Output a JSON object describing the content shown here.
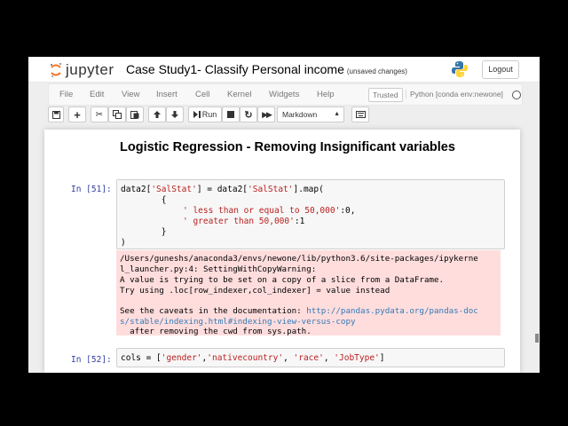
{
  "header": {
    "logo_text": "jupyter",
    "notebook_title": "Case Study1- Classify Personal income",
    "autosave_status": "(unsaved changes)",
    "logout_label": "Logout"
  },
  "menubar": {
    "items": [
      "File",
      "Edit",
      "View",
      "Insert",
      "Cell",
      "Kernel",
      "Widgets",
      "Help"
    ],
    "trusted_label": "Trusted",
    "kernel_name": "Python [conda env:newone]"
  },
  "toolbar": {
    "run_label": "Run",
    "cell_type": "Markdown"
  },
  "cells": {
    "heading": "Logistic Regression - Removing Insignificant variables",
    "cell1": {
      "prompt": "In [51]:",
      "line1_a": "data2[",
      "line1_b": "'SalStat'",
      "line1_c": "] = data2[",
      "line1_d": "'SalStat'",
      "line1_e": "].map(",
      "line2": "        {",
      "line3_str": "' less than or equal to 50,000'",
      "line3_rest": ":0,",
      "line4_str": "' greater than 50,000'",
      "line4_rest": ":1",
      "line5": "        }",
      "line6": ")"
    },
    "stderr": {
      "line1": "/Users/guneshs/anaconda3/envs/newone/lib/python3.6/site-packages/ipykerne",
      "line2": "l_launcher.py:4: SettingWithCopyWarning:",
      "line3": "A value is trying to be set on a copy of a slice from a DataFrame.",
      "line4": "Try using .loc[row_indexer,col_indexer] = value instead",
      "line5_text": "See the caveats in the documentation: ",
      "line5_link": "http://pandas.pydata.org/pandas-doc",
      "line6_link": "s/stable/indexing.html#indexing-view-versus-copy",
      "line7": "  after removing the cwd from sys.path."
    },
    "cell2": {
      "prompt": "In [52]:",
      "code_a": "cols = [",
      "s1": "'gender'",
      "sep1": ",",
      "s2": "'nativecountry'",
      "sep2": ", ",
      "s3": "'race'",
      "sep3": ", ",
      "s4": "'JobType'",
      "code_end": "]"
    }
  },
  "colors": {
    "prompt": "#303f9f",
    "string": "#ba2121",
    "keyword": "#aa22ff",
    "stderr_bg": "#ffdddd",
    "link": "#337ab7"
  }
}
